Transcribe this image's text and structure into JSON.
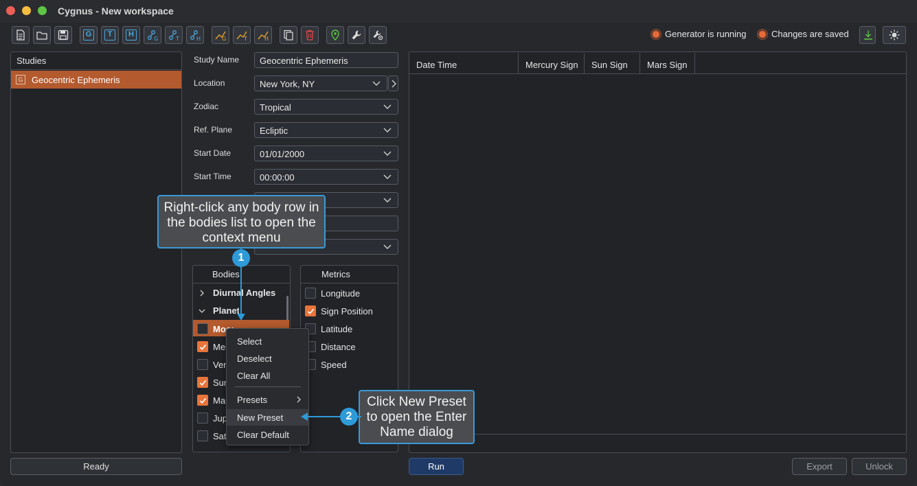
{
  "window": {
    "title": "Cygnus - New workspace"
  },
  "toolbar": {
    "letters": [
      "G",
      "T",
      "H"
    ]
  },
  "status": {
    "generator": "Generator is running",
    "saved": "Changes are saved"
  },
  "studies": {
    "header": "Studies",
    "items": [
      {
        "label": "Geocentric Ephemeris",
        "type": "G"
      }
    ]
  },
  "form": {
    "study_name": {
      "label": "Study Name",
      "value": "Geocentric Ephemeris"
    },
    "location": {
      "label": "Location",
      "value": "New York, NY"
    },
    "zodiac": {
      "label": "Zodiac",
      "value": "Tropical"
    },
    "ref_plane": {
      "label": "Ref. Plane",
      "value": "Ecliptic"
    },
    "start_date": {
      "label": "Start Date",
      "value": "01/01/2000"
    },
    "start_time": {
      "label": "Start Time",
      "value": "00:00:00"
    }
  },
  "tooltips": {
    "step1": "Right-click any body row in the bodies list to open the context menu",
    "step2": "Click New Preset to open the Enter Name dialog",
    "badge1": "1",
    "badge2": "2"
  },
  "bodies": {
    "header": "Bodies",
    "groups": [
      "Diurnal Angles",
      "Planets"
    ],
    "items": [
      {
        "label": "Moon",
        "checked": false
      },
      {
        "label": "Mercury",
        "checked": true
      },
      {
        "label": "Venus",
        "checked": false
      },
      {
        "label": "Sun",
        "checked": true
      },
      {
        "label": "Mars",
        "checked": true
      },
      {
        "label": "Jupiter",
        "checked": false
      },
      {
        "label": "Saturn",
        "checked": false
      }
    ]
  },
  "metrics": {
    "header": "Metrics",
    "items": [
      {
        "label": "Longitude",
        "checked": false
      },
      {
        "label": "Sign Position",
        "checked": true
      },
      {
        "label": "Latitude",
        "checked": false
      },
      {
        "label": "Distance",
        "checked": false
      },
      {
        "label": "Speed",
        "checked": false
      }
    ]
  },
  "context_menu": {
    "items": [
      "Select",
      "Deselect",
      "Clear All",
      "Presets",
      "New Preset",
      "Clear Default"
    ]
  },
  "table": {
    "columns": [
      "Date Time",
      "Mercury Sign",
      "Sun Sign",
      "Mars Sign"
    ]
  },
  "footer": {
    "ready": "Ready",
    "run": "Run",
    "export": "Export",
    "unlock": "Unlock"
  },
  "colors": {
    "accent": "#e8743a",
    "highlight": "#b35a2e",
    "callout": "#2e9ad8"
  }
}
